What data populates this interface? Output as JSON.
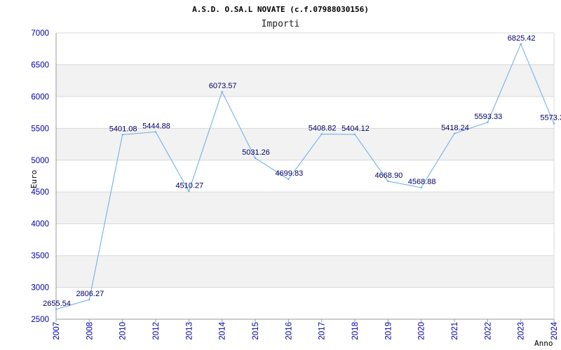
{
  "chart_data": {
    "type": "line",
    "title": "A.S.D. O.SA.L NOVATE (c.f.07988030156)",
    "subtitle": "Importi",
    "xlabel": "Anno",
    "ylabel": "Euro",
    "x": [
      "2007",
      "2008",
      "2010",
      "2012",
      "2013",
      "2014",
      "2015",
      "2016",
      "2017",
      "2018",
      "2019",
      "2020",
      "2021",
      "2022",
      "2023",
      "2024"
    ],
    "series": [
      {
        "values": [
          2655.54,
          2806.27,
          5401.08,
          5444.88,
          4510.27,
          6073.57,
          5031.26,
          4699.83,
          5408.82,
          5404.12,
          4668.9,
          4568.88,
          5418.24,
          5593.33,
          6825.42,
          5573.3
        ],
        "labels": [
          "2655.54",
          "2806.27",
          "5401.08",
          "5444.88",
          "4510.27",
          "6073.57",
          "5031.26",
          "4699.83",
          "5408.82",
          "5404.12",
          "4668.90",
          "4568.88",
          "5418.24",
          "5593.33",
          "6825.42",
          "5573.3"
        ]
      }
    ],
    "ylim": [
      2500,
      7000
    ],
    "yticks": [
      "2500",
      "3000",
      "3500",
      "4000",
      "4500",
      "5000",
      "5500",
      "6000",
      "6500",
      "7000"
    ],
    "grid": "horizontal bands",
    "colors": {
      "line": "#66aaee",
      "band": "#f2f2f2",
      "grid": "#d8d8d8",
      "tick_text": "#0000aa",
      "data_label": "#000066"
    }
  }
}
